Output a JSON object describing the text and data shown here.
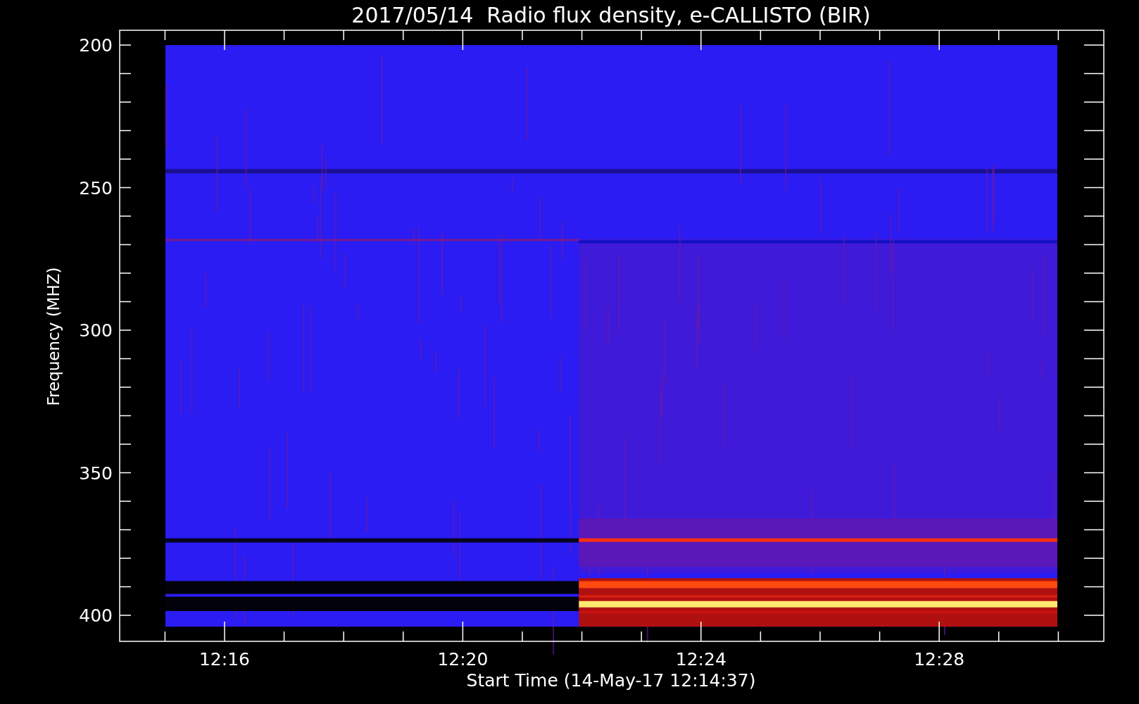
{
  "title": "2017/05/14  Radio flux density, e-CALLISTO (BIR)",
  "y_axis": {
    "label": "Frequency (MHZ)",
    "ticks": [
      "200",
      "250",
      "300",
      "350",
      "400"
    ]
  },
  "x_axis": {
    "label": "Start Time (14-May-17 12:14:37)",
    "ticks": [
      "12:16",
      "12:20",
      "12:24",
      "12:28"
    ]
  }
}
